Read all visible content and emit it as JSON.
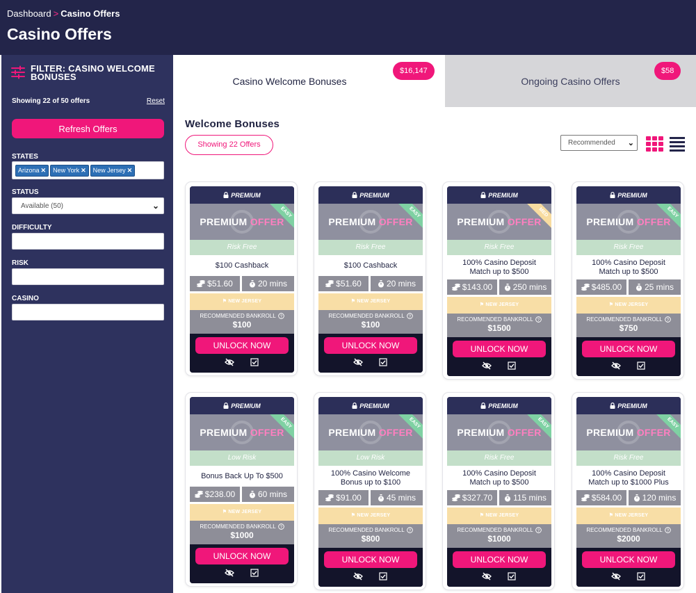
{
  "header": {
    "breadcrumb_root": "Dashboard",
    "breadcrumb_sep": ">",
    "breadcrumb_current": "Casino Offers",
    "title": "Casino Offers"
  },
  "sidebar": {
    "filter_title": "FILTER: CASINO WELCOME BONUSES",
    "showing": "Showing 22 of 50 offers",
    "reset": "Reset",
    "refresh": "Refresh Offers",
    "states_label": "STATES",
    "states": [
      "Arizona",
      "New York",
      "New Jersey"
    ],
    "status_label": "STATUS",
    "status_value": "Available (50)",
    "difficulty_label": "DIFFICULTY",
    "risk_label": "RISK",
    "casino_label": "CASINO"
  },
  "tabs": [
    {
      "label": "Casino Welcome Bonuses",
      "badge": "$16,147"
    },
    {
      "label": "Ongoing Casino Offers",
      "badge": "$58"
    }
  ],
  "main": {
    "section_title": "Welcome Bonuses",
    "showing_pill": "Showing 22 Offers",
    "sort_value": "Recommended"
  },
  "colors": {
    "accent": "#f0177a",
    "ribbon_easy": "#7fd1a3",
    "ribbon_med": "#f8dca0"
  },
  "card_common": {
    "premium": "PREMIUM",
    "banner_a": "PREMIUM",
    "banner_b": "OFFER",
    "state": "NEW JERSEY",
    "bankroll_label": "RECOMMENDED BANKROLL",
    "unlock": "UNLOCK NOW"
  },
  "cards": [
    {
      "risk": "Risk Free",
      "title": "$100 Cashback",
      "value": "$51.60",
      "time": "20 mins",
      "bankroll": "$100",
      "difficulty": "EASY"
    },
    {
      "risk": "Risk Free",
      "title": "$100 Cashback",
      "value": "$51.60",
      "time": "20 mins",
      "bankroll": "$100",
      "difficulty": "EASY"
    },
    {
      "risk": "Risk Free",
      "title": "100% Casino Deposit Match up to $500",
      "value": "$143.00",
      "time": "250 mins",
      "bankroll": "$1500",
      "difficulty": "MED"
    },
    {
      "risk": "Risk Free",
      "title": "100% Casino Deposit Match up to $500",
      "value": "$485.00",
      "time": "25 mins",
      "bankroll": "$750",
      "difficulty": "EASY"
    },
    {
      "risk": "Low Risk",
      "title": "Bonus Back Up To $500",
      "value": "$238.00",
      "time": "60 mins",
      "bankroll": "$1000",
      "difficulty": "EASY"
    },
    {
      "risk": "Low Risk",
      "title": "100% Casino Welcome Bonus up to $100",
      "value": "$91.00",
      "time": "45 mins",
      "bankroll": "$800",
      "difficulty": "EASY"
    },
    {
      "risk": "Risk Free",
      "title": "100% Casino Deposit Match up to $500",
      "value": "$327.70",
      "time": "115 mins",
      "bankroll": "$1000",
      "difficulty": "EASY"
    },
    {
      "risk": "Risk Free",
      "title": "100% Casino Deposit Match up to $1000 Plus",
      "value": "$584.00",
      "time": "120 mins",
      "bankroll": "$2000",
      "difficulty": "EASY"
    }
  ]
}
